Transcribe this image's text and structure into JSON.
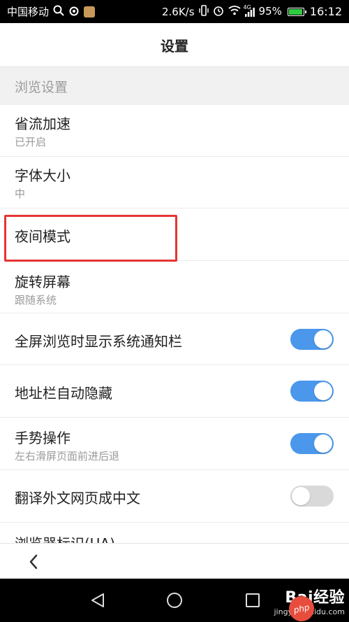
{
  "status_bar": {
    "carrier": "中国移动",
    "speed": "2.6K/s",
    "network": "4G",
    "battery": "95%",
    "battery_level": 0.95,
    "time": "16:12"
  },
  "header": {
    "title": "设置"
  },
  "section": {
    "label": "浏览设置"
  },
  "settings": [
    {
      "title": "省流加速",
      "subtitle": "已开启"
    },
    {
      "title": "字体大小",
      "subtitle": "中"
    },
    {
      "title": "夜间模式"
    },
    {
      "title": "旋转屏幕",
      "subtitle": "跟随系统"
    },
    {
      "title": "全屏浏览时显示系统通知栏",
      "toggle": true
    },
    {
      "title": "地址栏自动隐藏",
      "toggle": true
    },
    {
      "title": "手势操作",
      "subtitle": "左右滑屏页面前进后退",
      "toggle": true
    },
    {
      "title": "翻译外文网页成中文",
      "toggle": false
    },
    {
      "title": "浏览器标识(UA)"
    }
  ],
  "colors": {
    "toggle_on": "#4a97ec",
    "toggle_off": "#d9d9d9",
    "highlight": "#e53535"
  },
  "icons": {
    "back": "chevron-left-icon",
    "nav_back": "triangle-back-icon",
    "nav_home": "circle-home-icon",
    "nav_recent": "square-recent-icon"
  },
  "watermark": {
    "logo": "Bai经验",
    "url": "jingyan.baidu.com",
    "badge": "php"
  }
}
